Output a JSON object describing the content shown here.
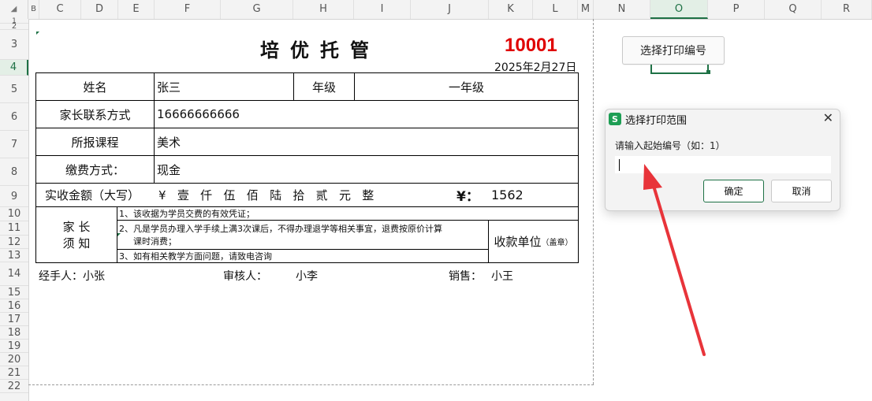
{
  "corner": "◢",
  "columns": [
    "B",
    "C",
    "D",
    "E",
    "F",
    "G",
    "H",
    "I",
    "J",
    "K",
    "L",
    "M",
    "N",
    "O",
    "P",
    "Q",
    "R"
  ],
  "selected_column": "O",
  "rows": [
    "1",
    "2",
    "3",
    "4",
    "5",
    "6",
    "7",
    "8",
    "9",
    "10",
    "11",
    "12",
    "13",
    "14",
    "15",
    "16",
    "17",
    "18",
    "19",
    "20",
    "21",
    "22"
  ],
  "selected_row": "4",
  "receipt": {
    "title": "培优托管",
    "serial": "10001",
    "serial_color": "#e00000",
    "date": "2025年2月27日",
    "name_label": "姓名",
    "name_value": "张三",
    "grade_label": "年级",
    "grade_value": "一年级",
    "phone_label": "家长联系方式",
    "phone_value": "16666666666",
    "course_label": "所报课程",
    "course_value": "美术",
    "payment_label": "缴费方式：",
    "payment_value": "现金",
    "amount_label": "实收金额（大写）",
    "amount_words": "¥   壹   仟   伍   佰   陆   拾   贰   元   整",
    "amount_symbol": "¥：",
    "amount_value": "1562",
    "notice_label_1": "家  长",
    "notice_label_2": "须  知",
    "notice_1": "1、该收据为学员交费的有效凭证；",
    "notice_2a": "2、凡是学员办理入学手续上满3次课后，不得办理退学等相关事宜，退费按原价计算",
    "notice_2b": "课时消费；",
    "notice_3": "3、如有相关教学方面问题，请致电咨询",
    "payee_label": "收款单位",
    "payee_note": "（盖章）",
    "handler": "经手人：小张",
    "reviewer_label": "审核人：",
    "reviewer_value": "小李",
    "seller_label": "销售：",
    "seller_value": "小王"
  },
  "print_button": "选择打印编号",
  "dialog": {
    "icon": "S",
    "icon_color": "#1d9e54",
    "title": "选择打印范围",
    "close": "✕",
    "prompt": "请输入起始编号（如：1）",
    "input_value": "",
    "ok": "确定",
    "cancel": "取消"
  },
  "arrow_color": "#e8343a"
}
